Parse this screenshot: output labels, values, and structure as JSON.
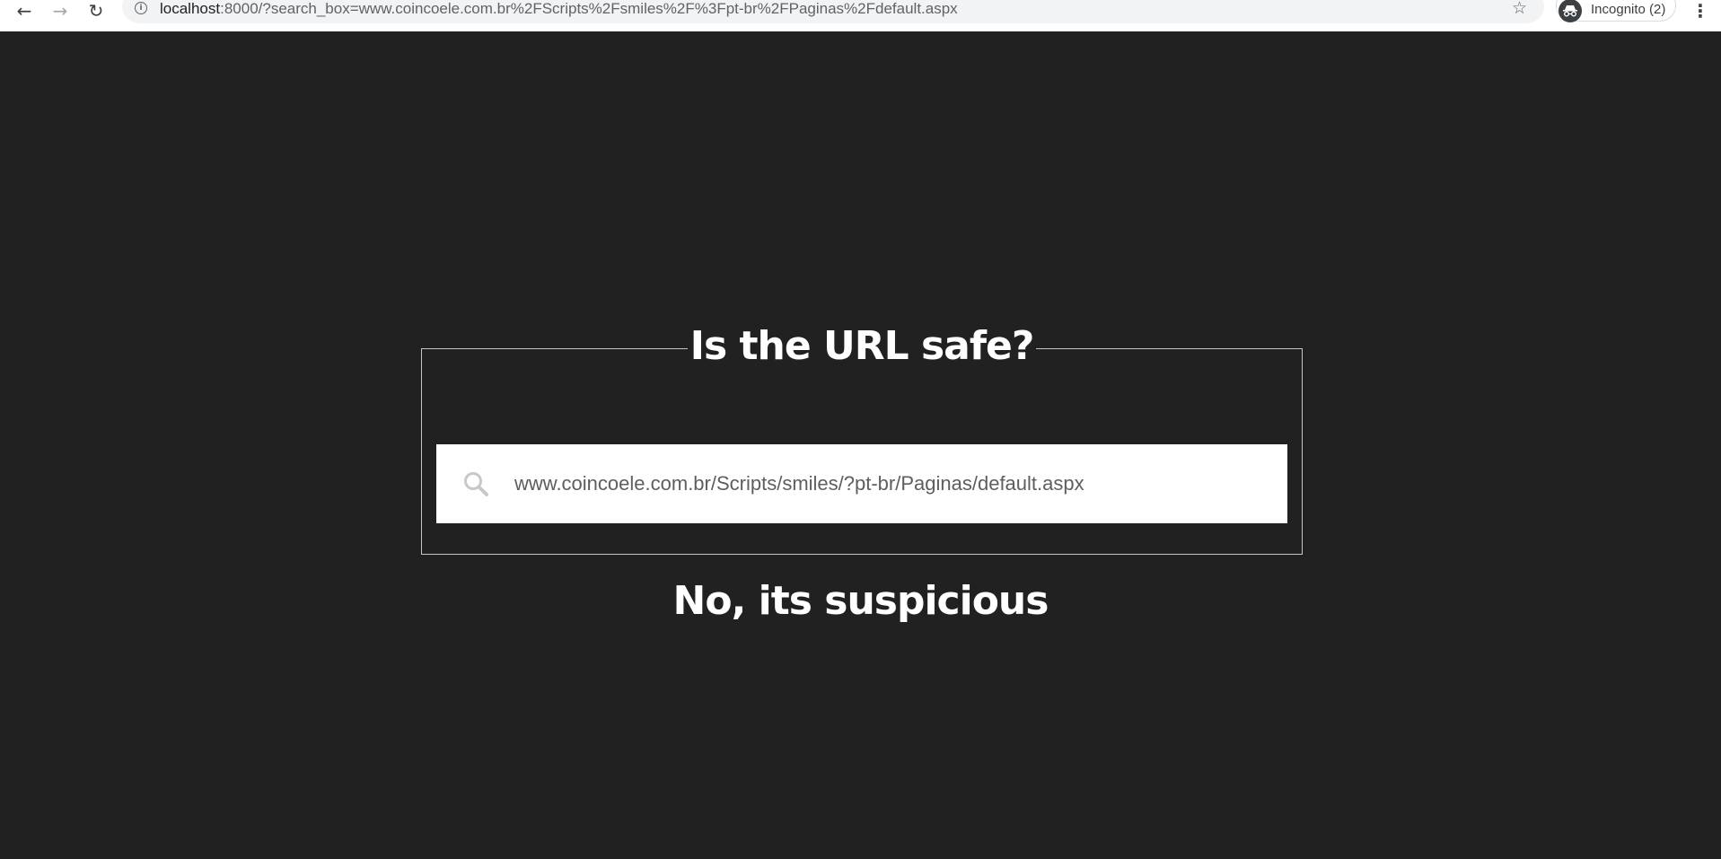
{
  "browser": {
    "back_icon": "arrow-left-icon",
    "forward_icon": "arrow-right-icon",
    "reload_icon": "reload-icon",
    "info_icon": "info-icon",
    "url_host": "localhost",
    "url_rest": ":8000/?search_box=www.coincoele.com.br%2FScripts%2Fsmiles%2F%3Fpt-br%2FPaginas%2Fdefault.aspx",
    "star_icon": "star-icon",
    "incognito_icon": "incognito-icon",
    "incognito_label": "Incognito (2)",
    "menu_icon": "kebab-menu-icon"
  },
  "main": {
    "title": "Is the URL safe?",
    "search": {
      "icon": "search-icon",
      "value": "www.coincoele.com.br/Scripts/smiles/?pt-br/Paginas/default.aspx"
    },
    "result": "No, its suspicious"
  },
  "colors": {
    "background": "#212121",
    "text": "#ffffff",
    "box_border": "#c6c6c6",
    "input_background": "#ffffff",
    "input_text": "#5e5e5e",
    "search_icon": "#c8c8c8"
  }
}
